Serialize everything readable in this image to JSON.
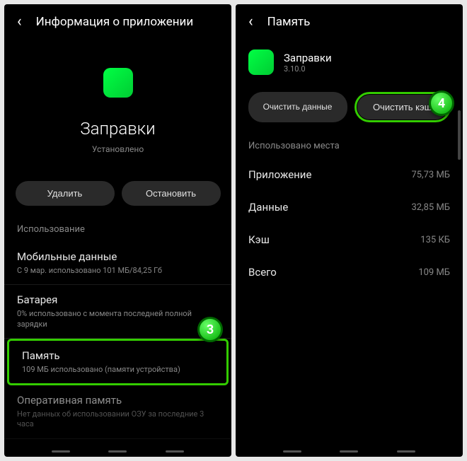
{
  "left": {
    "header": {
      "title": "Информация о приложении"
    },
    "app": {
      "name": "Заправки",
      "status": "Установлено"
    },
    "buttons": {
      "uninstall": "Удалить",
      "stop": "Остановить"
    },
    "section_usage": "Использование",
    "items": {
      "mobile_data": {
        "title": "Мобильные данные",
        "sub": "С 9 мар. использовано 101 МБ/84,25 Гб"
      },
      "battery": {
        "title": "Батарея",
        "sub": "0% использовано с момента последней полной зарядки"
      },
      "memory": {
        "title": "Память",
        "sub": "109 МБ использовано (памяти устройства)"
      },
      "ram": {
        "title": "Оперативная память",
        "sub": "Нет данных об использовании ОЗУ за последние 3 часа"
      }
    },
    "step": "3"
  },
  "right": {
    "header": {
      "title": "Память"
    },
    "app": {
      "name": "Заправки",
      "version": "3.10.0"
    },
    "buttons": {
      "clear_data": "Очистить данные",
      "clear_cache": "Очистить кэш"
    },
    "section_space": "Использовано места",
    "storage": {
      "app": {
        "label": "Приложение",
        "value": "75,73 МБ"
      },
      "data": {
        "label": "Данные",
        "value": "32,85 МБ"
      },
      "cache": {
        "label": "Кэш",
        "value": "135 КБ"
      },
      "total": {
        "label": "Всего",
        "value": "109 МБ"
      }
    },
    "step": "4"
  }
}
